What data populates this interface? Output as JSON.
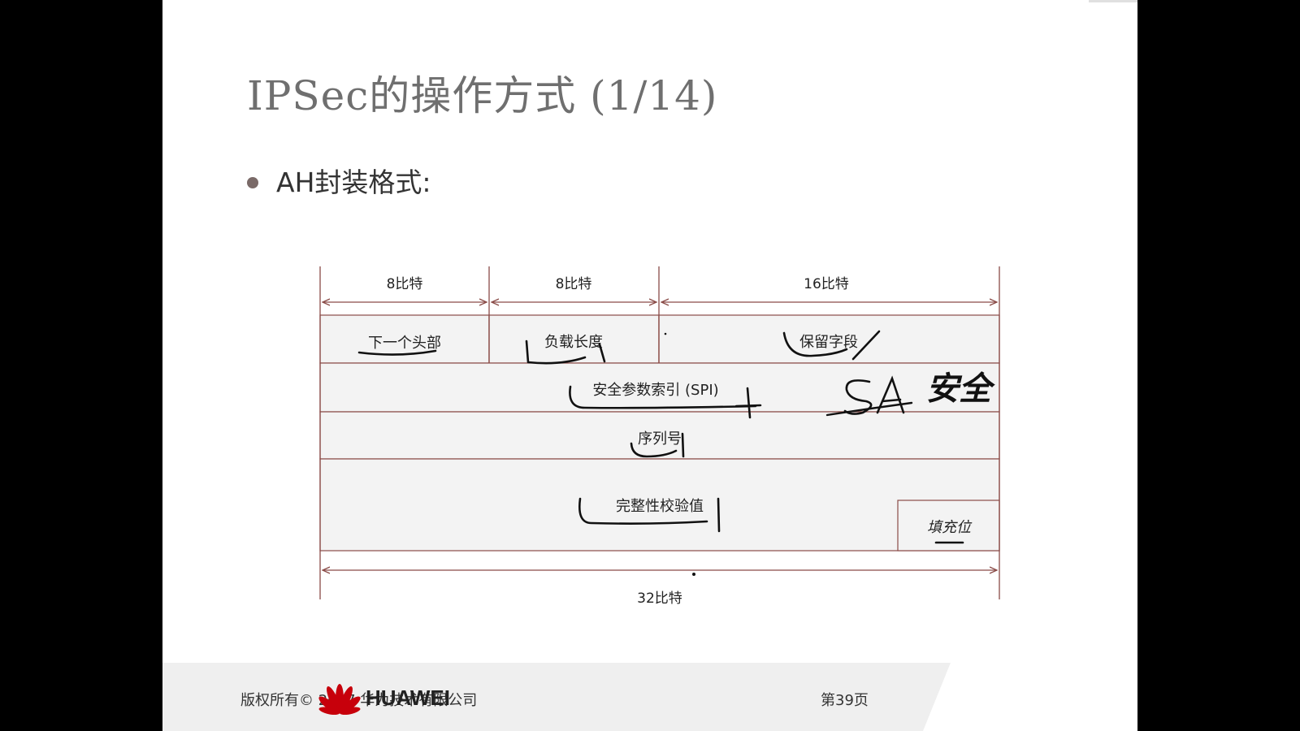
{
  "slide": {
    "title": "IPSec的操作方式 (1/14)",
    "bullet": "AH封装格式:"
  },
  "diagram": {
    "width_labels": [
      "8比特",
      "8比特",
      "16比特"
    ],
    "total_width_label": "32比特",
    "fields": {
      "next_header": "下一个头部",
      "payload_length": "负载长度",
      "reserved": "保留字段",
      "spi": "安全参数索引 (SPI)",
      "sequence_number": "序列号",
      "icv": "完整性校验值",
      "padding": "填充位"
    },
    "handwritten_annotation": "SA 安全"
  },
  "footer": {
    "copyright": "版权所有© 2017 华为技术有限公司",
    "page": "第39页",
    "brand": "HUAWEI"
  },
  "colors": {
    "frame_lines": "#8a4b47",
    "field_fill": "#f3f3f3",
    "ink": "#111111",
    "footer_bg": "#efefef",
    "logo_red": "#c7000b"
  }
}
